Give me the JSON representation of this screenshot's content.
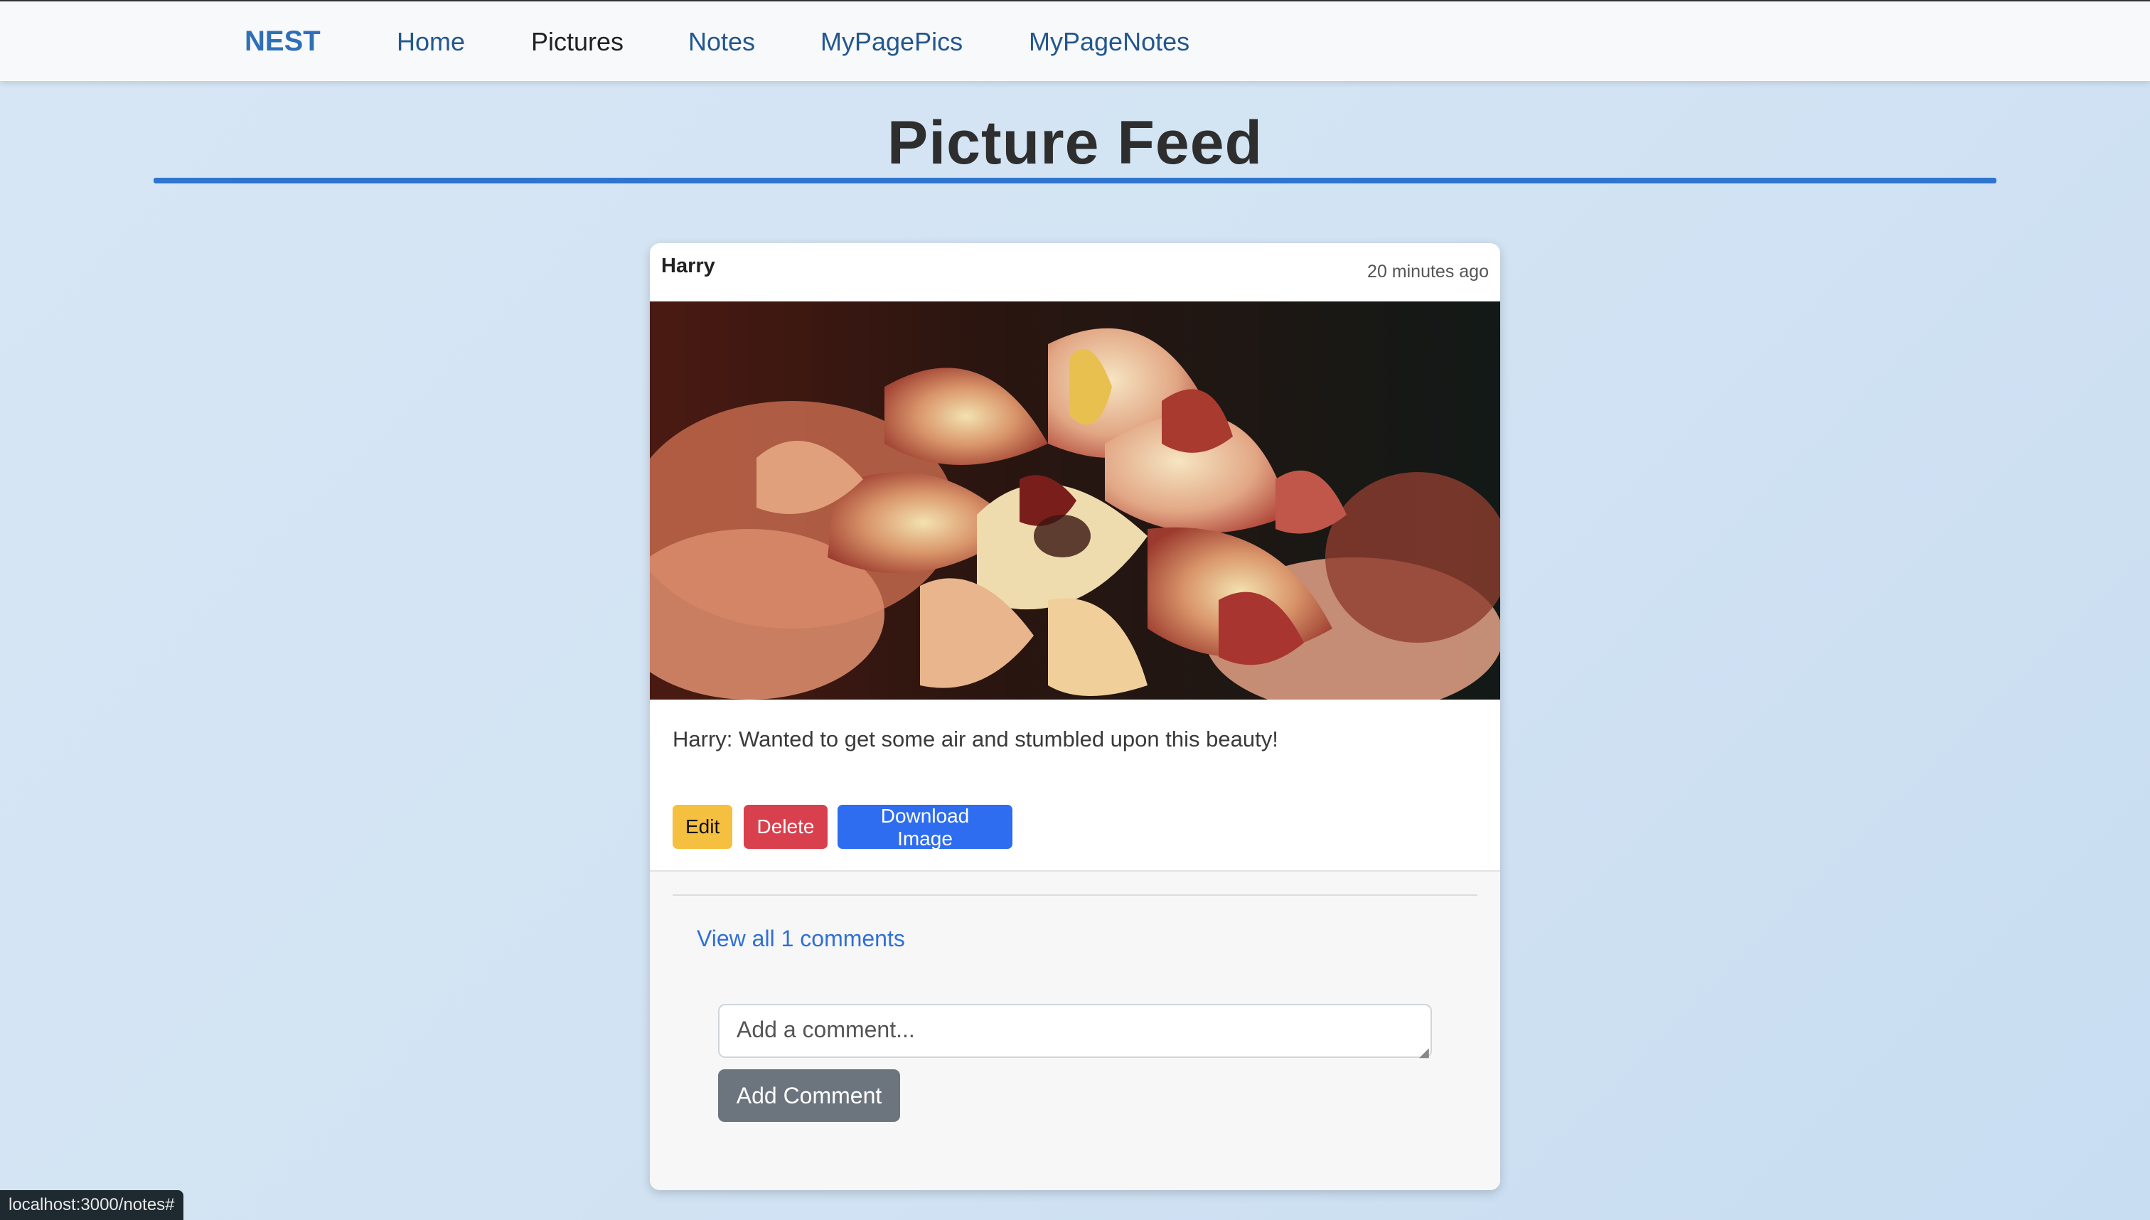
{
  "nav": {
    "brand": "NEST",
    "items": [
      {
        "label": "Home"
      },
      {
        "label": "Pictures"
      },
      {
        "label": "Notes"
      },
      {
        "label": "MyPagePics"
      },
      {
        "label": "MyPageNotes"
      }
    ],
    "active": "Pictures"
  },
  "page": {
    "title": "Picture Feed"
  },
  "post": {
    "author": "Harry",
    "timestamp": "20 minutes ago",
    "image_icon": "flower-photo",
    "caption": "Harry: Wanted to get some air and stumbled upon this beauty!",
    "actions": {
      "edit": "Edit",
      "delete": "Delete",
      "download": "Download Image"
    },
    "comments": {
      "view_all": "View all 1 comments",
      "input_placeholder": "Add a comment...",
      "input_value": "",
      "submit": "Add Comment"
    }
  },
  "status_bar": {
    "url": "localhost:3000/notes#"
  },
  "colors": {
    "brand": "#2f6fb8",
    "accent": "#2f75cf",
    "edit": "#f5c03f",
    "delete": "#d9404d",
    "download": "#2e6cf0",
    "add_comment": "#6c757d"
  }
}
